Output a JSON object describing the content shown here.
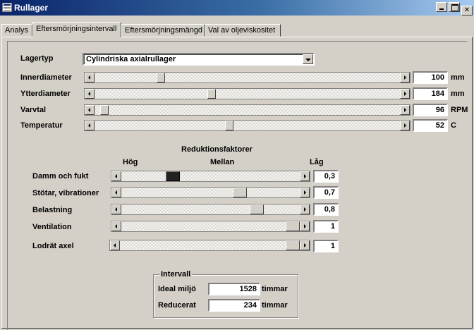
{
  "window": {
    "title": "Rullager"
  },
  "tabs": [
    {
      "label": "Analys",
      "active": false
    },
    {
      "label": "Eftersmörjningsintervall",
      "active": true
    },
    {
      "label": "Eftersmörjningsmängd",
      "active": false
    },
    {
      "label": "Val av oljeviskositet",
      "active": false
    }
  ],
  "bearing": {
    "type_label": "Lagertyp",
    "type_value": "Cylindriska axialrullager",
    "params": [
      {
        "label": "Innerdiameter",
        "value": "100",
        "unit": "mm",
        "level": 0.21
      },
      {
        "label": "Ytterdiameter",
        "value": "184",
        "unit": "mm",
        "level": 0.38
      },
      {
        "label": "Varvtal",
        "value": "96",
        "unit": "RPM",
        "level": 0.02
      },
      {
        "label": "Temperatur",
        "value": "52",
        "unit": "C",
        "level": 0.44
      }
    ]
  },
  "reduction": {
    "title": "Reduktionsfaktorer",
    "scale_high": "Hög",
    "scale_mid": "Mellan",
    "scale_low": "Låg",
    "factors": [
      {
        "label": "Damm och fukt",
        "value": "0,3",
        "level": 0.27,
        "focused": true
      },
      {
        "label": "Stötar, vibrationer",
        "value": "0,7",
        "level": 0.68,
        "focused": false
      },
      {
        "label": "Belastning",
        "value": "0,8",
        "level": 0.78,
        "focused": false
      },
      {
        "label": "Ventilation",
        "value": "1",
        "level": 1.0,
        "focused": false
      },
      {
        "label": "Lodrät axel",
        "value": "1",
        "level": 1.0,
        "focused": false
      }
    ]
  },
  "interval": {
    "title": "Intervall",
    "ideal_label": "Ideal miljö",
    "ideal_value": "1528",
    "reduced_label": "Reducerat",
    "reduced_value": "234",
    "unit": "timmar"
  }
}
